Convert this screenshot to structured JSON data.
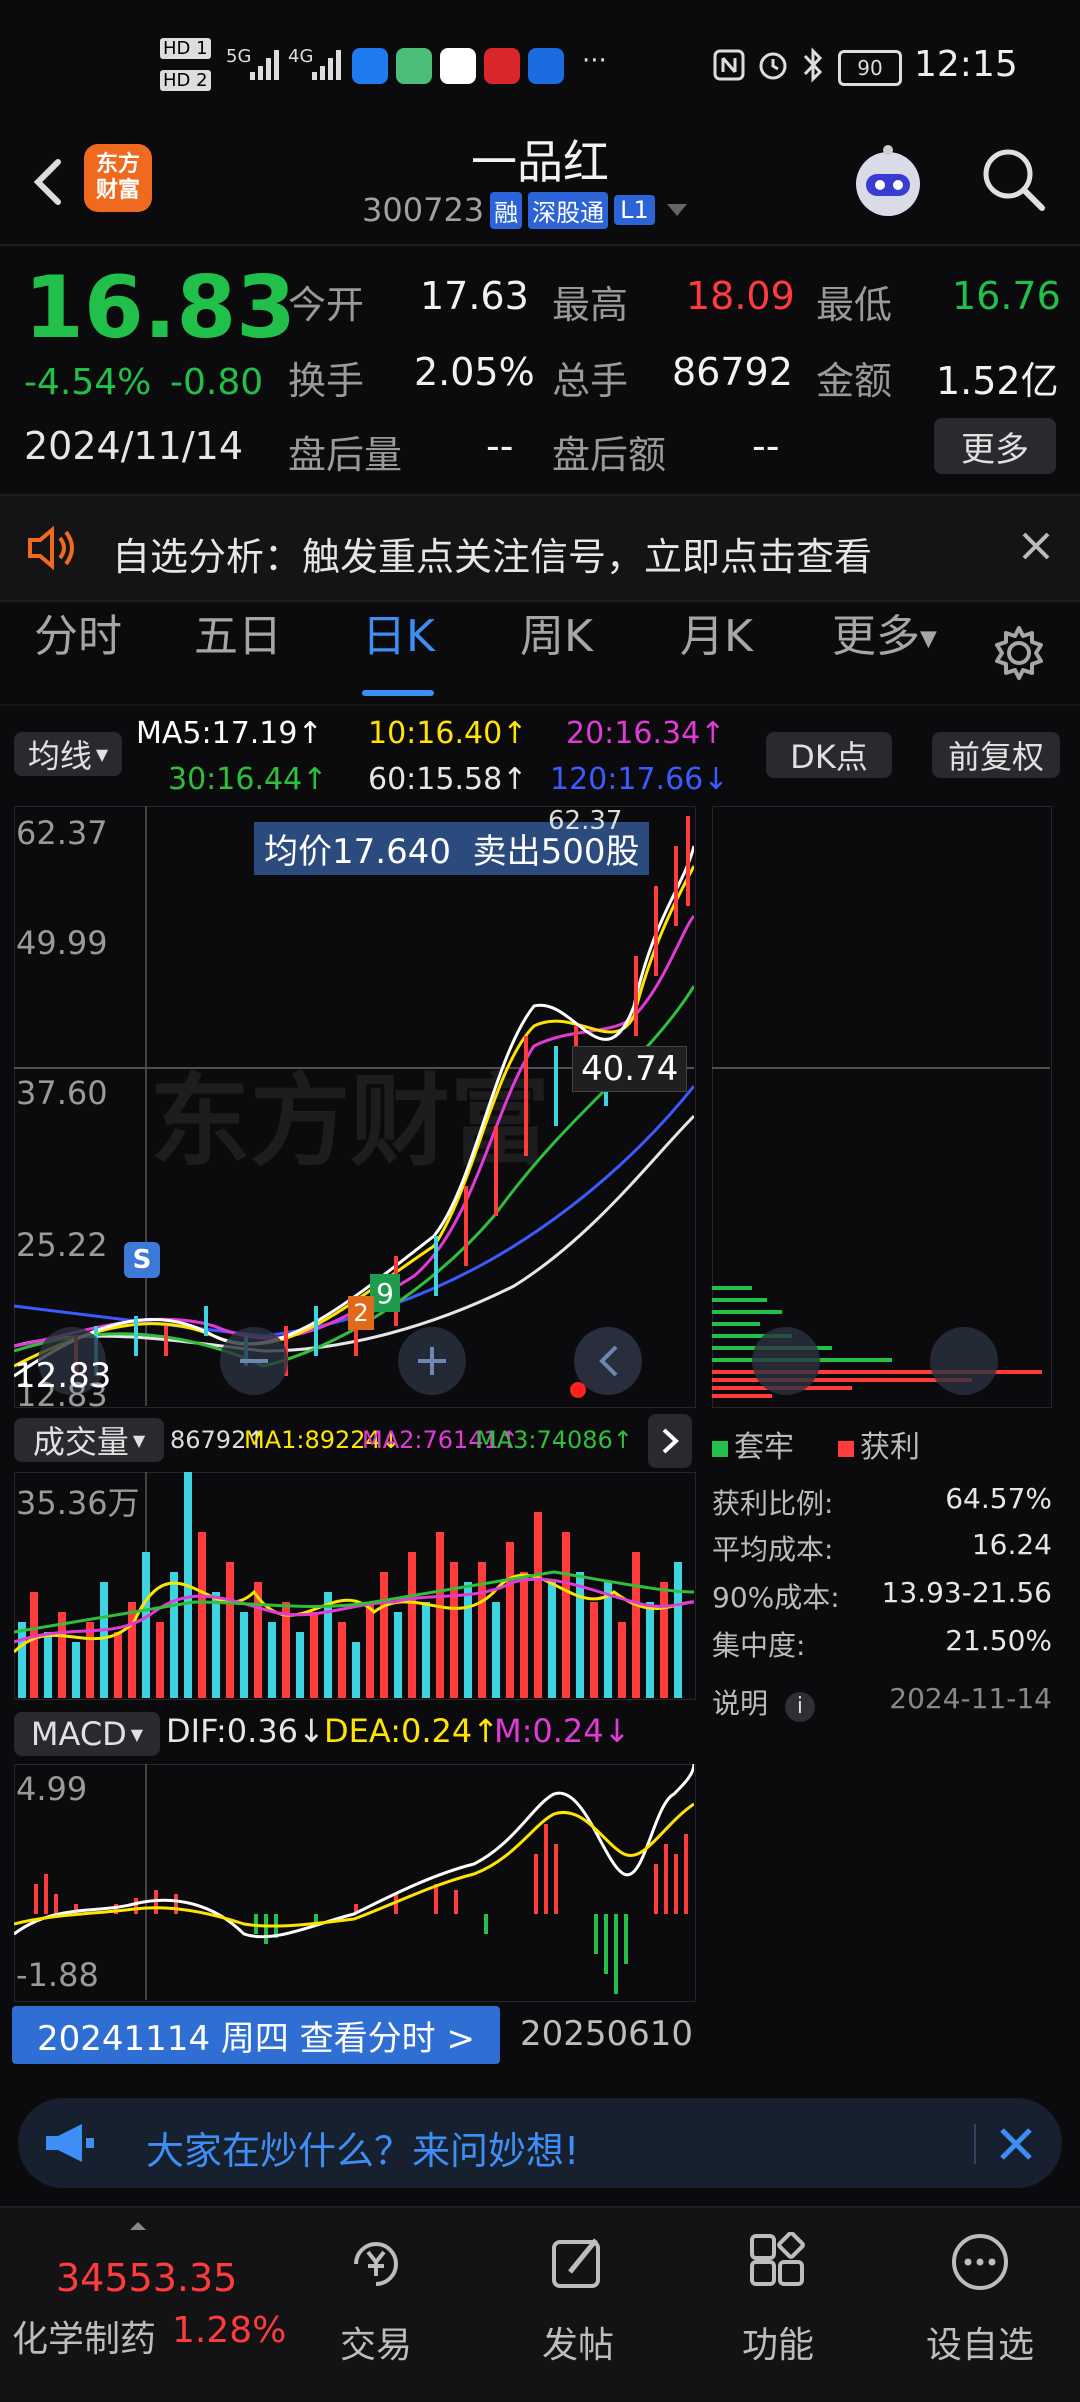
{
  "status_bar": {
    "hd1": "HD 1",
    "hd2": "HD 2",
    "sig1": "5G",
    "sig2": "4G",
    "battery": "90",
    "time": "12:15",
    "more": "···"
  },
  "header": {
    "app_logo_text": "东方\n财富",
    "stock_name": "一品红",
    "stock_code": "300723",
    "badge_rong": "融",
    "badge_sgt": "深股通",
    "badge_l1": "L1"
  },
  "quote": {
    "price": "16.83",
    "change_pct": "-4.54%",
    "change": "-0.80",
    "date": "2024/11/14",
    "open_label": "今开",
    "open": "17.63",
    "high_label": "最高",
    "high": "18.09",
    "low_label": "最低",
    "low": "16.76",
    "turnover_label": "换手",
    "turnover": "2.05%",
    "volume_label": "总手",
    "volume": "86792",
    "amount_label": "金额",
    "amount": "1.52亿",
    "ah_vol_label": "盘后量",
    "ah_vol": "--",
    "ah_amt_label": "盘后额",
    "ah_amt": "--",
    "more_button": "更多"
  },
  "notice": {
    "text": "自选分析：触发重点关注信号，立即点击查看"
  },
  "tabs": [
    "分时",
    "五日",
    "日K",
    "周K",
    "月K",
    "更多"
  ],
  "active_tab": 2,
  "ma_bar": {
    "selector": "均线",
    "ma5": "MA5:17.19↑",
    "ma10": "10:16.40↑",
    "ma20": "20:16.34↑",
    "ma30": "30:16.44↑",
    "ma60": "60:15.58↑",
    "ma120": "120:17.66↓",
    "dk_button": "DK点",
    "fq_button": "前复权"
  },
  "kline": {
    "y_labels": [
      "62.37",
      "49.99",
      "37.60",
      "25.22",
      "12.83"
    ],
    "tooltip": "均价17.640  卖出500股",
    "top_marker": "62.37",
    "crosshair_value": "40.74",
    "low_marker": "12.83",
    "watermark": "东方财富",
    "markers": {
      "s": "S",
      "nine": "9",
      "two": "2"
    }
  },
  "volume": {
    "selector": "成交量",
    "v": "86792↑",
    "ma1": "MA1:89224↓",
    "ma2": "MA2:76141↑",
    "ma3": "MA3:74086↑",
    "y_label": "35.36万"
  },
  "macd": {
    "selector": "MACD",
    "dif": "DIF:0.36↓",
    "dea": "DEA:0.24↑",
    "m": "M:0.24↓",
    "y_top": "4.99",
    "y_bottom": "-1.88"
  },
  "date_bar": {
    "left": "20241114 周四 查看分时 >",
    "right": "20250610"
  },
  "chip_panel": {
    "legend_trapped": "套牢",
    "legend_profit": "获利",
    "rows": [
      {
        "label": "获利比例:",
        "value": "64.57%"
      },
      {
        "label": "平均成本:",
        "value": "16.24"
      },
      {
        "label": "90%成本:",
        "value": "13.93-21.56"
      },
      {
        "label": "集中度:",
        "value": "21.50%"
      }
    ],
    "note_label": "说明",
    "note_date": "2024-11-14"
  },
  "ask_bar": {
    "text": "大家在炒什么？来问妙想!"
  },
  "bottom_nav": {
    "index_value": "34553.35",
    "index_name": "化学制药",
    "index_change": "1.28%",
    "items": [
      "交易",
      "发帖",
      "功能",
      "设自选"
    ]
  },
  "colors": {
    "up": "#ff3b3b",
    "down": "#20c04a",
    "accent": "#3d8ff5",
    "ma5": "#ffffff",
    "ma10": "#ffe400",
    "ma20": "#e13ad6",
    "ma30": "#2fbf3a",
    "ma60": "#e6e6e6",
    "ma120": "#3c5bff"
  }
}
